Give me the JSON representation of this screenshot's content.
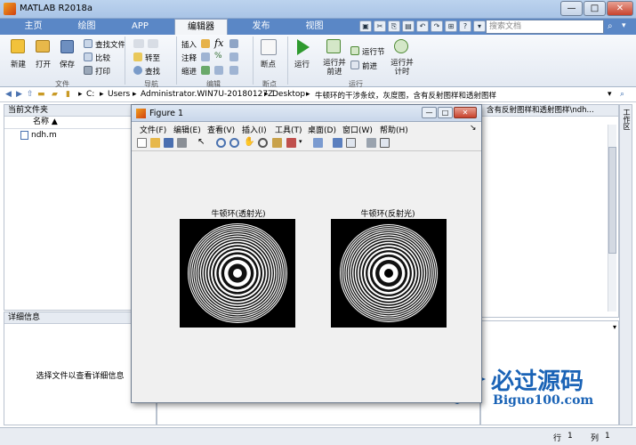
{
  "app": {
    "title": "MATLAB R2018a",
    "window_buttons": [
      "—",
      "□",
      "✕"
    ]
  },
  "tabs": [
    {
      "label": "主页",
      "active": false
    },
    {
      "label": "绘图",
      "active": false
    },
    {
      "label": "APP",
      "active": false
    },
    {
      "label": "编辑器",
      "active": true
    },
    {
      "label": "发布",
      "active": false
    },
    {
      "label": "视图",
      "active": false
    }
  ],
  "search": {
    "placeholder": "搜索文档"
  },
  "ribbon": {
    "file": {
      "new": "新建",
      "open": "打开",
      "save": "保存",
      "find_files": "查找文件",
      "compare": "比较",
      "print": "打印",
      "group": "文件"
    },
    "navigate": {
      "goto": "转至",
      "find": "查找",
      "group": "导航"
    },
    "edit": {
      "insert": "插入",
      "comment": "注释",
      "indent": "缩进",
      "fx": "fx",
      "group": "编辑"
    },
    "breakpoints": {
      "label": "断点",
      "group": "断点"
    },
    "run": {
      "run": "运行",
      "run_advance": "运行并\n前进",
      "run_section": "运行节",
      "advance": "前进",
      "run_time": "运行并\n计时",
      "group": "运行"
    }
  },
  "address": {
    "segments": [
      "C:",
      "Users",
      "Administrator.WIN7U-20180127Z",
      "Desktop",
      "牛顿环的干涉条纹，灰度图，含有反射图样和透射图样"
    ],
    "right_tab": "含有反射图样和透射图样\\ndh..."
  },
  "current_folder": {
    "header": "当前文件夹",
    "column": "名称 ▲",
    "files": [
      "ndh.m"
    ]
  },
  "details": {
    "header": "详细信息",
    "hint": "选择文件以查看详细信息"
  },
  "workspace_label": "工作区",
  "status": {
    "line_label": "行",
    "line": "1",
    "col_label": "列",
    "col": "1"
  },
  "figure": {
    "title": "Figure 1",
    "menu": [
      "文件(F)",
      "编辑(E)",
      "查看(V)",
      "插入(I)",
      "工具(T)",
      "桌面(D)",
      "窗口(W)",
      "帮助(H)"
    ],
    "plots": [
      {
        "title": "牛顿环(透射光)",
        "type": "transmission"
      },
      {
        "title": "牛顿环(反射光)",
        "type": "reflection"
      }
    ]
  },
  "watermark": {
    "cn": "必过源码",
    "en": "Biguo100.com"
  },
  "colors": {
    "tab_bar": "#5a87c6",
    "ribbon": "#e9eef5",
    "watermark": "#1a63b6"
  }
}
